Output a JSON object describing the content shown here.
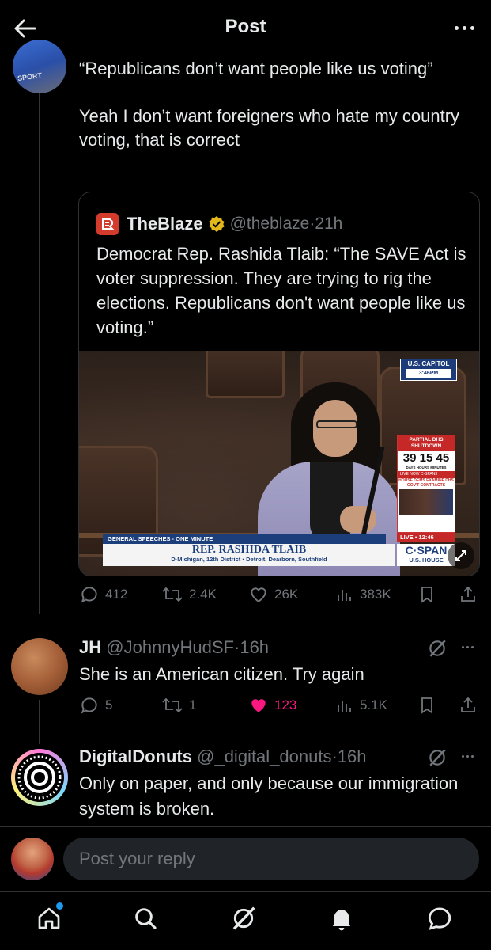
{
  "header": {
    "title": "Post"
  },
  "main_post": {
    "paragraphs": [
      "“Republicans don’t want people like us voting”",
      "Yeah I don’t want foreigners who hate my country voting, that is correct"
    ],
    "avatar_text": "SPORT"
  },
  "quote": {
    "name": "TheBlaze",
    "handle": "@theblaze",
    "time": "21h",
    "text": "Democrat Rep. Rashida Tlaib: “The SAVE Act is voter suppression. They are trying to rig the elections. Republicans don't want people like us voting.”",
    "video": {
      "corner_title": "U.S. CAPITOL",
      "corner_time": "3:46PM",
      "dhs_header": "PARTIAL DHS SHUTDOWN",
      "dhs_counter": "39 15 45",
      "dhs_units": "DAYS   HOURS   MINUTES",
      "dhs_live": "LIVE NOW C-SPAN3",
      "dhs_item": "HOUSE DEMS EXAMINE DHS GOV'T CONTRACTS",
      "lower_bar": "GENERAL SPEECHES - ONE MINUTE",
      "lower_name": "REP. RASHIDA TLAIB",
      "lower_sub": "D-Michigan, 12th District  ▪  Detroit, Dearborn, Southfield",
      "live": "LIVE ▪ 12:46",
      "network": "C·SPAN",
      "network_sub": "U.S. HOUSE"
    }
  },
  "main_actions": {
    "replies": "412",
    "reposts": "2.4K",
    "likes": "26K",
    "views": "383K"
  },
  "replies": [
    {
      "name": "JH",
      "handle": "@JohnnyHudSF",
      "time": "16h",
      "text": "She is an American citizen. Try again",
      "replies": "5",
      "reposts": "1",
      "likes": "123",
      "views": "5.1K"
    },
    {
      "name": "DigitalDonuts",
      "handle": "@_digital_donuts",
      "time": "16h",
      "text": "Only on paper, and only because our immigration system is broken."
    }
  ],
  "composer": {
    "placeholder": "Post your reply"
  },
  "colors": {
    "background": "#000000",
    "text": "#e7e9ea",
    "muted": "#71767b",
    "like_active": "#f91880",
    "accent": "#1d9bf0",
    "blaze_red": "#d33b2c",
    "verified_gold": "#e2b719"
  },
  "icons": [
    "back-arrow-icon",
    "more-icon",
    "reply-icon",
    "repost-icon",
    "like-icon",
    "views-icon",
    "bookmark-icon",
    "share-icon",
    "grok-icon",
    "home-icon",
    "search-icon",
    "notifications-icon",
    "messages-icon"
  ]
}
